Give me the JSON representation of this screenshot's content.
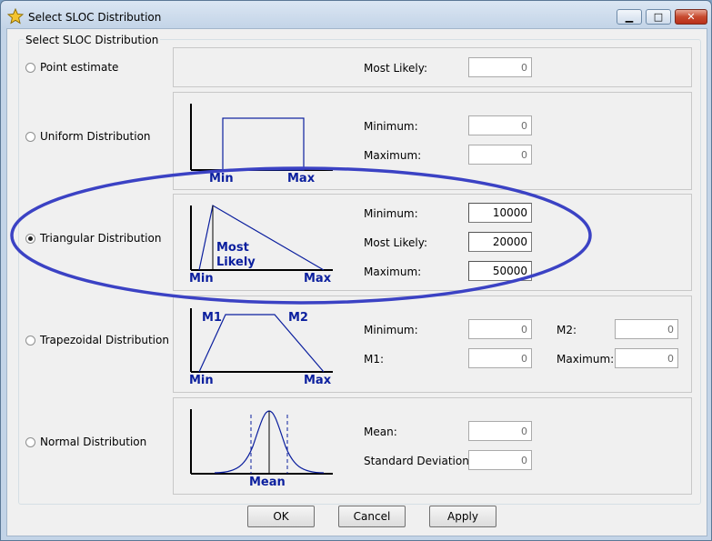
{
  "window": {
    "title": "Select SLOC Distribution",
    "controls": {
      "minimize": "minimize-icon",
      "maximize": "maximize-icon",
      "close": "close-icon"
    }
  },
  "group_label": "Select SLOC Distribution",
  "options": {
    "point": {
      "label": "Point estimate",
      "selected": false,
      "fields": {
        "most_likely_label": "Most Likely:",
        "most_likely_value": "0"
      }
    },
    "uniform": {
      "label": "Uniform Distribution",
      "selected": false,
      "diagram": {
        "min": "Min",
        "max": "Max"
      },
      "fields": {
        "minimum_label": "Minimum:",
        "minimum_value": "0",
        "maximum_label": "Maximum:",
        "maximum_value": "0"
      }
    },
    "triangular": {
      "label": "Triangular Distribution",
      "selected": true,
      "diagram": {
        "min": "Min",
        "most": "Most",
        "likely": "Likely",
        "max": "Max"
      },
      "fields": {
        "minimum_label": "Minimum:",
        "minimum_value": "10000",
        "most_likely_label": "Most Likely:",
        "most_likely_value": "20000",
        "maximum_label": "Maximum:",
        "maximum_value": "50000"
      }
    },
    "trapezoidal": {
      "label": "Trapezoidal Distribution",
      "selected": false,
      "diagram": {
        "m1": "M1",
        "m2": "M2",
        "min": "Min",
        "max": "Max"
      },
      "fields": {
        "minimum_label": "Minimum:",
        "minimum_value": "0",
        "m1_label": "M1:",
        "m1_value": "0",
        "m2_label": "M2:",
        "m2_value": "0",
        "maximum_label": "Maximum:",
        "maximum_value": "0"
      }
    },
    "normal": {
      "label": "Normal Distribution",
      "selected": false,
      "diagram": {
        "mean": "Mean"
      },
      "fields": {
        "mean_label": "Mean:",
        "mean_value": "0",
        "sd_label": "Standard Deviation:",
        "sd_value": "0"
      }
    }
  },
  "buttons": {
    "ok": "OK",
    "cancel": "Cancel",
    "apply": "Apply"
  },
  "colors": {
    "diagram_blue": "#0b1f9e",
    "highlight_ellipse": "#3b42c4",
    "window_frame": "#c3d4e7",
    "dialog_bg": "#f0f0f0"
  }
}
